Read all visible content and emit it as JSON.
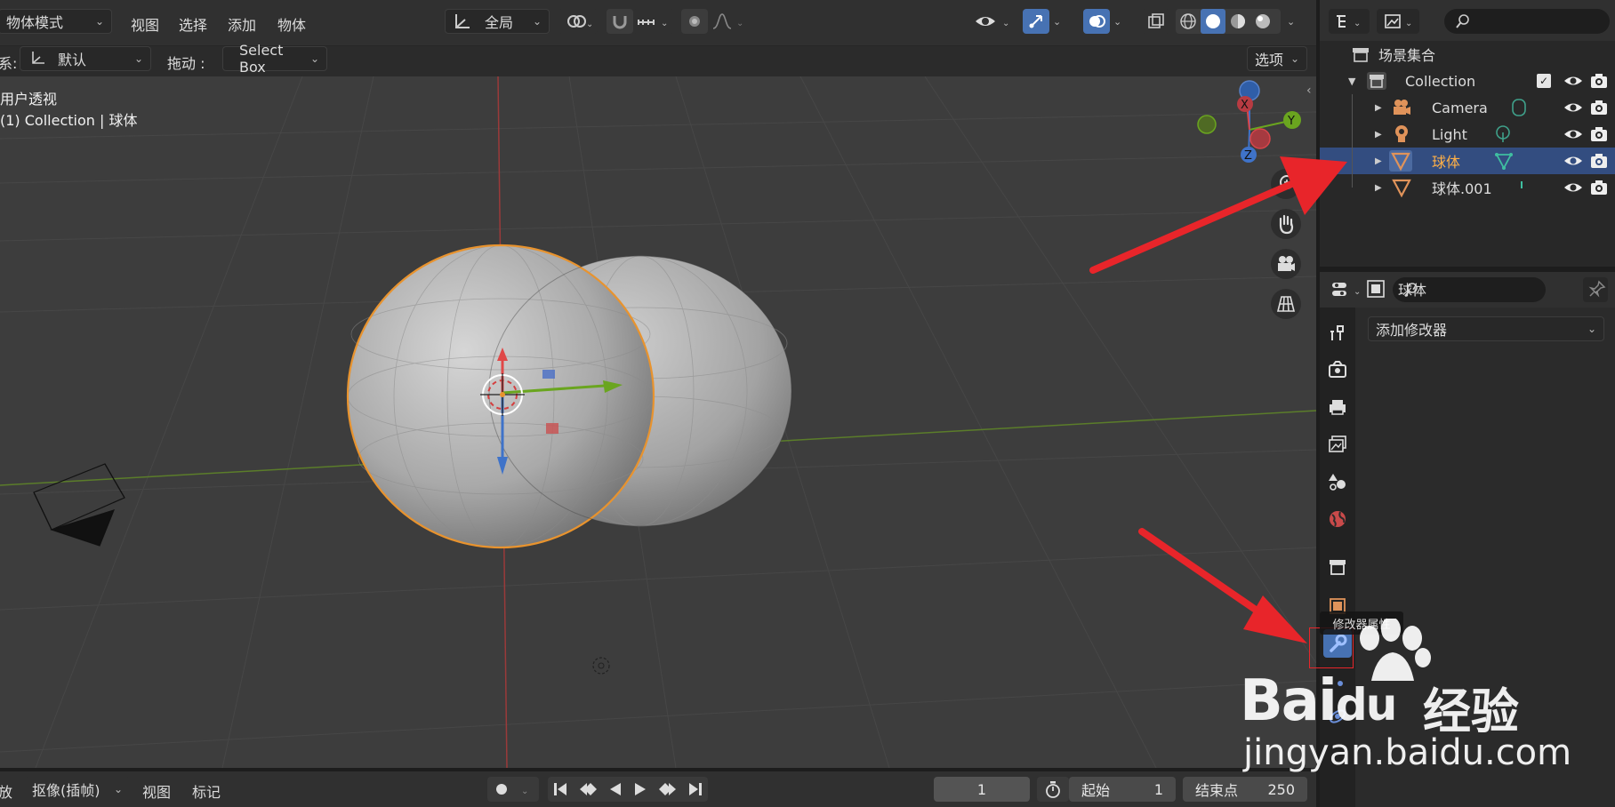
{
  "header": {
    "mode": "物体模式",
    "menu": [
      "视图",
      "选择",
      "添加",
      "物体"
    ],
    "transform_orientation": "全局"
  },
  "toolbar": {
    "coord_label": "系:",
    "coord_value": "默认",
    "drag_label": "拖动 :",
    "drag_value": "Select Box",
    "options_label": "选项"
  },
  "viewport": {
    "view_name": "用户透视",
    "context": "(1) Collection | 球体",
    "gizmo_axes": [
      "X",
      "Y",
      "Z"
    ]
  },
  "outliner": {
    "root": "场景集合",
    "collection": "Collection",
    "items": [
      {
        "label": "Camera",
        "icon": "camera-icon",
        "color": "#e0935a"
      },
      {
        "label": "Light",
        "icon": "light-icon",
        "color": "#e0935a"
      },
      {
        "label": "球体",
        "icon": "mesh-icon",
        "color": "#e0935a",
        "selected": true
      },
      {
        "label": "球体.001",
        "icon": "mesh-icon",
        "color": "#e0935a"
      }
    ]
  },
  "properties": {
    "object_name": "球体",
    "add_modifier": "添加修改器",
    "tooltip": "修改器属性"
  },
  "timeline": {
    "playback_label": "放",
    "keying_label": "抠像(插帧)",
    "view_label": "视图",
    "marker_label": "标记",
    "current_frame": "1",
    "start_label": "起始",
    "start_value": "1",
    "end_label": "结束点",
    "end_value": "250"
  },
  "watermark": {
    "brand": "Bai",
    "brand_tail": "du",
    "product": "经验",
    "url": "jingyan.baidu.com"
  },
  "colors": {
    "accent": "#4772b3",
    "selection_outline": "#e8932e",
    "x_axis": "#d8454a",
    "y_axis": "#6aa51f",
    "z_axis": "#3f73c9",
    "annotation_arrow": "#e8252a"
  }
}
